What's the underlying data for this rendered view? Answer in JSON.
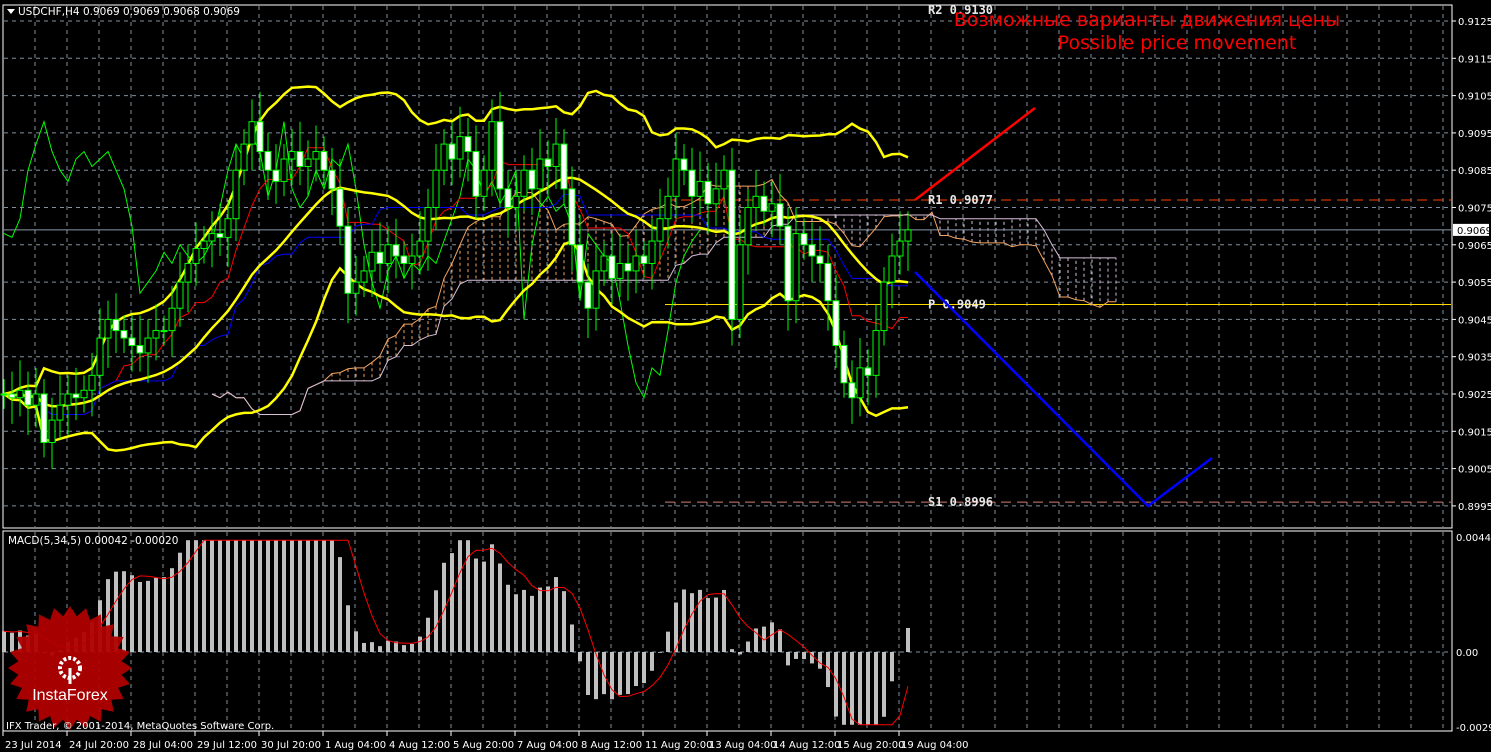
{
  "chart_data": {
    "type": "candlestick",
    "title": "USDCHF,H4  0.9069 0.9069 0.9068 0.9069",
    "symbol": "USDCHF,H4",
    "ohlc_last": "0.9069 0.9069 0.9068 0.9069",
    "ylim": [
      0.899,
      0.913
    ],
    "y_ticks": [
      "0.9125",
      "0.9115",
      "0.9105",
      "0.9095",
      "0.9085",
      "0.9075",
      "0.9065",
      "0.9055",
      "0.9045",
      "0.9035",
      "0.9025",
      "0.9015",
      "0.9005",
      "0.8995"
    ],
    "current_price": "0.9069",
    "x_ticks": [
      "23 Jul 2014",
      "24 Jul 20:00",
      "28 Jul 04:00",
      "29 Jul 12:00",
      "30 Jul 20:00",
      "1 Aug 04:00",
      "4 Aug 12:00",
      "5 Aug 20:00",
      "7 Aug 04:00",
      "8 Aug 12:00",
      "11 Aug 20:00",
      "13 Aug 04:00",
      "14 Aug 12:00",
      "15 Aug 20:00",
      "19 Aug 04:00"
    ],
    "closes": [
      0.9025,
      0.9024,
      0.9026,
      0.9022,
      0.9025,
      0.9012,
      0.9018,
      0.9022,
      0.9025,
      0.9024,
      0.9026,
      0.903,
      0.904,
      0.9045,
      0.9042,
      0.904,
      0.9038,
      0.9036,
      0.904,
      0.9042,
      0.9042,
      0.9048,
      0.9055,
      0.906,
      0.9064,
      0.9066,
      0.9068,
      0.9067,
      0.9072,
      0.9085,
      0.9092,
      0.9098,
      0.909,
      0.9085,
      0.9082,
      0.9088,
      0.909,
      0.9086,
      0.9088,
      0.909,
      0.9085,
      0.908,
      0.907,
      0.9052,
      0.9055,
      0.9058,
      0.9063,
      0.906,
      0.9065,
      0.9062,
      0.906,
      0.9062,
      0.9066,
      0.9075,
      0.9085,
      0.9092,
      0.9088,
      0.9094,
      0.909,
      0.9078,
      0.9085,
      0.9098,
      0.908,
      0.9075,
      0.9078,
      0.9085,
      0.908,
      0.9088,
      0.9086,
      0.9092,
      0.908,
      0.9065,
      0.9055,
      0.9048,
      0.9058,
      0.9062,
      0.9056,
      0.906,
      0.9058,
      0.9062,
      0.906,
      0.9066,
      0.9072,
      0.9078,
      0.9088,
      0.9085,
      0.9078,
      0.9082,
      0.9076,
      0.908,
      0.9085,
      0.9045,
      0.9065,
      0.9075,
      0.9078,
      0.9074,
      0.9076,
      0.907,
      0.905,
      0.9068,
      0.9065,
      0.9062,
      0.906,
      0.905,
      0.9038,
      0.9028,
      0.9024,
      0.9032,
      0.903,
      0.9042,
      0.9055,
      0.9062,
      0.9066,
      0.9069
    ],
    "indicators": [
      "Bollinger Bands (20,2)",
      "Ichimoku Kinko Hyo",
      "MACD(5,34,5)"
    ],
    "levels": [
      {
        "name": "R2",
        "label": "R2 0.9130",
        "value": 0.913
      },
      {
        "name": "R1",
        "label": "R1 0.9077",
        "value": 0.9077
      },
      {
        "name": "P",
        "label": "P 0.9049",
        "value": 0.9049
      },
      {
        "name": "S1",
        "label": "S1 0.8996",
        "value": 0.8996
      }
    ],
    "macd": {
      "label": "MACD(5,34,5) 0.00042 -0.00020",
      "ylim": [
        -0.0029,
        0.0044
      ],
      "y_ticks": [
        "0.0044",
        "0.00",
        "-0.0029"
      ]
    }
  },
  "annotation": {
    "line1": "Возможные варианты движения цены",
    "line2": "Possible price movement"
  },
  "footer": "IFX Trader, © 2001-2014, MetaQuotes Software Corp.",
  "logo": "InstaForex",
  "colors": {
    "bull": "#00ff00",
    "bear": "#ffffff",
    "bands": "#ffff00",
    "tenkan": "#ff0000",
    "kijun": "#0000ff",
    "chikou": "#00ff00",
    "spanA": "#f4a460",
    "spanB": "#d8bfd8",
    "grid": "#8090a0"
  }
}
